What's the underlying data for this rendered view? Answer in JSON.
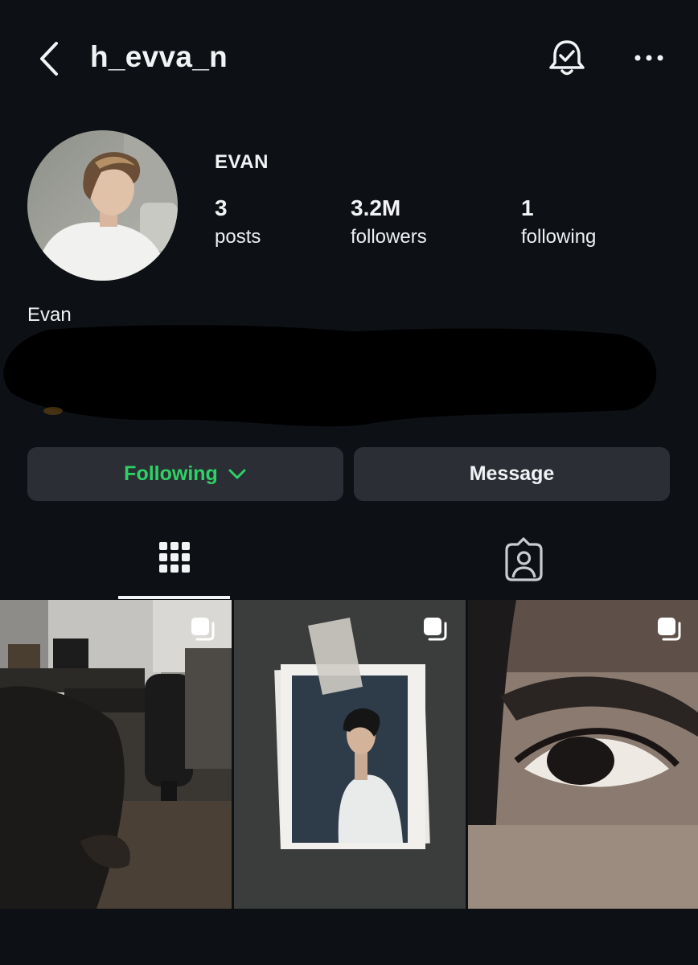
{
  "header": {
    "username": "h_evva_n",
    "back_icon": "chevron-left-icon",
    "bell_icon": "notification-bell-check-icon",
    "more_icon": "more-horizontal-icon"
  },
  "profile": {
    "display_name": "EVAN",
    "stats": [
      {
        "value": "3",
        "label": "posts"
      },
      {
        "value": "3.2M",
        "label": "followers"
      },
      {
        "value": "1",
        "label": "following"
      }
    ],
    "bio_name": "Evan"
  },
  "actions": {
    "following_label": "Following",
    "message_label": "Message",
    "following_color": "#2fd166"
  },
  "tabs": [
    {
      "icon": "grid-icon",
      "active": true
    },
    {
      "icon": "tagged-person-icon",
      "active": false
    }
  ],
  "posts": [
    {
      "type": "carousel",
      "icon": "multiple-posts-icon"
    },
    {
      "type": "carousel",
      "icon": "multiple-posts-icon"
    },
    {
      "type": "carousel",
      "icon": "multiple-posts-icon"
    }
  ],
  "colors": {
    "background": "#0d1014",
    "button_bg": "#2b2f35",
    "text": "#f2f3f5"
  }
}
